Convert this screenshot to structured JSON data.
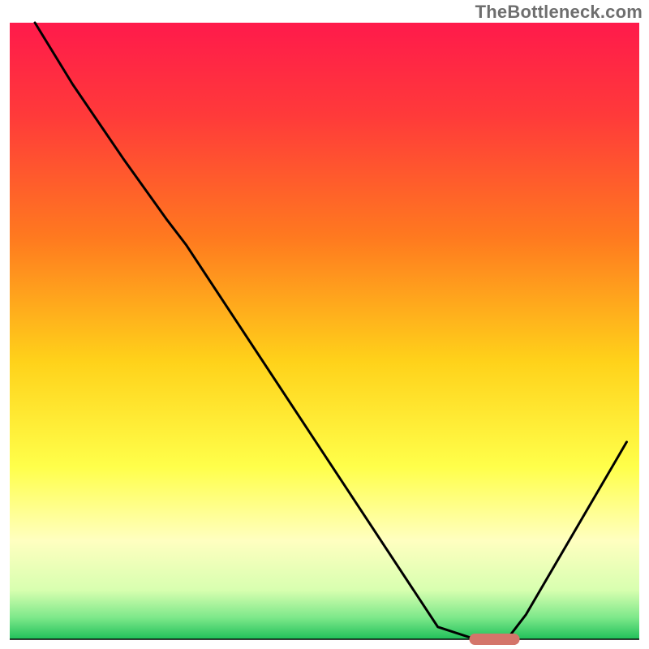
{
  "watermark": "TheBottleneck.com",
  "chart_data": {
    "type": "line",
    "title": "",
    "xlabel": "",
    "ylabel": "",
    "xlim": [
      0,
      100
    ],
    "ylim": [
      0,
      100
    ],
    "gradient_stops": [
      {
        "offset": 0.0,
        "color": "#ff1a4b"
      },
      {
        "offset": 0.15,
        "color": "#ff3a3a"
      },
      {
        "offset": 0.35,
        "color": "#ff7a1f"
      },
      {
        "offset": 0.55,
        "color": "#ffd21a"
      },
      {
        "offset": 0.72,
        "color": "#ffff4a"
      },
      {
        "offset": 0.84,
        "color": "#ffffc0"
      },
      {
        "offset": 0.92,
        "color": "#d8ffb0"
      },
      {
        "offset": 0.965,
        "color": "#7de88a"
      },
      {
        "offset": 1.0,
        "color": "#20c05a"
      }
    ],
    "series": [
      {
        "name": "bottleneck-curve",
        "x": [
          4,
          10,
          18,
          25,
          28,
          68,
          74,
          79,
          82,
          98
        ],
        "y": [
          100,
          90,
          78,
          68,
          64,
          2,
          0,
          0,
          4,
          32
        ]
      }
    ],
    "marker": {
      "name": "optimal-marker",
      "x_start": 73,
      "x_end": 81,
      "y": 0,
      "color": "#d4756a"
    },
    "axis_line_y": 0
  }
}
